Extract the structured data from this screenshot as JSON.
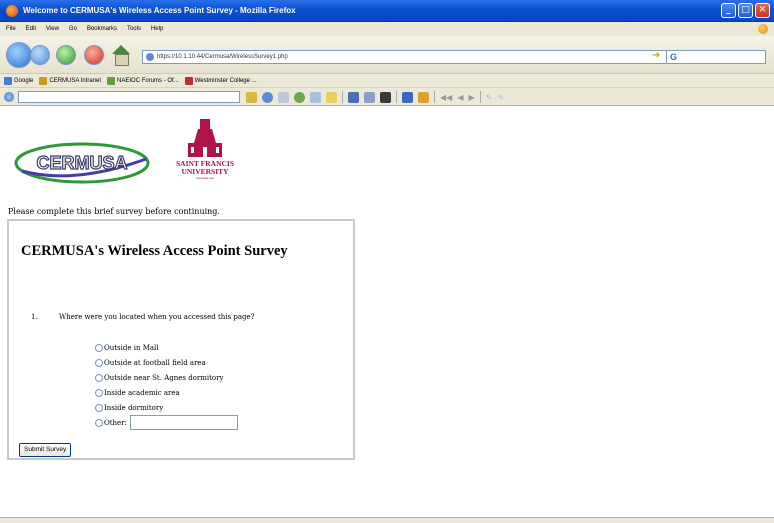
{
  "window": {
    "title": "Welcome to CERMUSA's Wireless Access Point Survey - Mozilla Firefox",
    "buttons": [
      "minimize",
      "maximize",
      "close"
    ]
  },
  "menu": [
    "File",
    "Edit",
    "View",
    "Go",
    "Bookmarks",
    "Tools",
    "Help"
  ],
  "navigation": {
    "url": "https://10.1.10.44/Cermusa/WirelessSurvey1.php",
    "search_engine_glyph": "G"
  },
  "bookmarks": [
    {
      "label": "Google",
      "color": "#4a7ad8"
    },
    {
      "label": "CERMUSA Intranet",
      "color": "#c8a020"
    },
    {
      "label": "NAEIOC Forums - Of...",
      "color": "#6a9a40"
    },
    {
      "label": "Westminster College ...",
      "color": "#c0302a"
    }
  ],
  "page": {
    "logo_left_text": "CERMUSA",
    "logo_right": {
      "line1": "SAINT FRANCIS",
      "line2": "UNIVERSITY",
      "line3": "FOUNDED 1847"
    },
    "intro": "Please complete this brief survey before continuing.",
    "survey": {
      "title": "CERMUSA's Wireless Access Point Survey",
      "question_number": "1.",
      "question": "Where were you located when you accessed this page?",
      "options": [
        "Outside in Mall",
        "Outside at football field area",
        "Outside near St. Agnes dormitory",
        "Inside academic area",
        "Inside dormitory",
        "Other:"
      ],
      "other_value": "",
      "submit_label": "Submit Survey"
    }
  }
}
